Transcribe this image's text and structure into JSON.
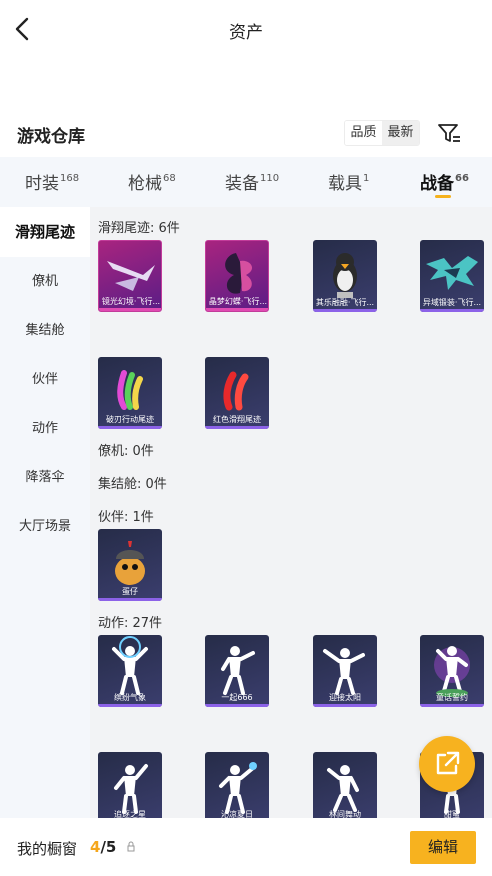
{
  "header": {
    "title": "资产",
    "back_icon": "chevron-left-icon"
  },
  "section": {
    "title": "游戏仓库",
    "sort_options": [
      "品质",
      "最新"
    ],
    "selected_sort": "最新",
    "filter_icon": "filter-icon"
  },
  "tabs": [
    {
      "label": "时装",
      "count": "168"
    },
    {
      "label": "枪械",
      "count": "68"
    },
    {
      "label": "装备",
      "count": "110"
    },
    {
      "label": "载具",
      "count": "1"
    },
    {
      "label": "战备",
      "count": "66",
      "active": true
    }
  ],
  "sidebar": {
    "items": [
      "滑翔尾迹",
      "僚机",
      "集结舱",
      "伙伴",
      "动作",
      "降落伞",
      "大厅场景"
    ],
    "active": "滑翔尾迹"
  },
  "groups": {
    "trails": {
      "label": "滑翔尾迹: 6件",
      "items": [
        "镜光幻境·飞行...",
        "晶梦幻蝶·飞行...",
        "其乐融融·飞行...",
        "异域锻装·飞行...",
        "破刃行动尾迹",
        "红色滑翔尾迹"
      ]
    },
    "wingman": {
      "label": "僚机: 0件"
    },
    "pod": {
      "label": "集结舱: 0件"
    },
    "partner": {
      "label": "伙伴: 1件",
      "items": [
        "蛋仔"
      ]
    },
    "emotes": {
      "label": "动作: 27件",
      "items": [
        "缤纷气象",
        "一起666",
        "迎接太阳",
        "童话誓约",
        "追逐之星",
        "沁凉夏日",
        "林间舞动",
        "甜蜜"
      ]
    }
  },
  "bottom": {
    "label": "我的橱窗",
    "count_current": "4",
    "count_total": "/5",
    "edit_label": "编辑",
    "lock_icon": "lock-icon"
  },
  "fab": {
    "icon": "share-external-icon"
  },
  "colors": {
    "accent": "#f7b21f",
    "legendary": "#e04ab2",
    "epic": "#8c62e8"
  }
}
